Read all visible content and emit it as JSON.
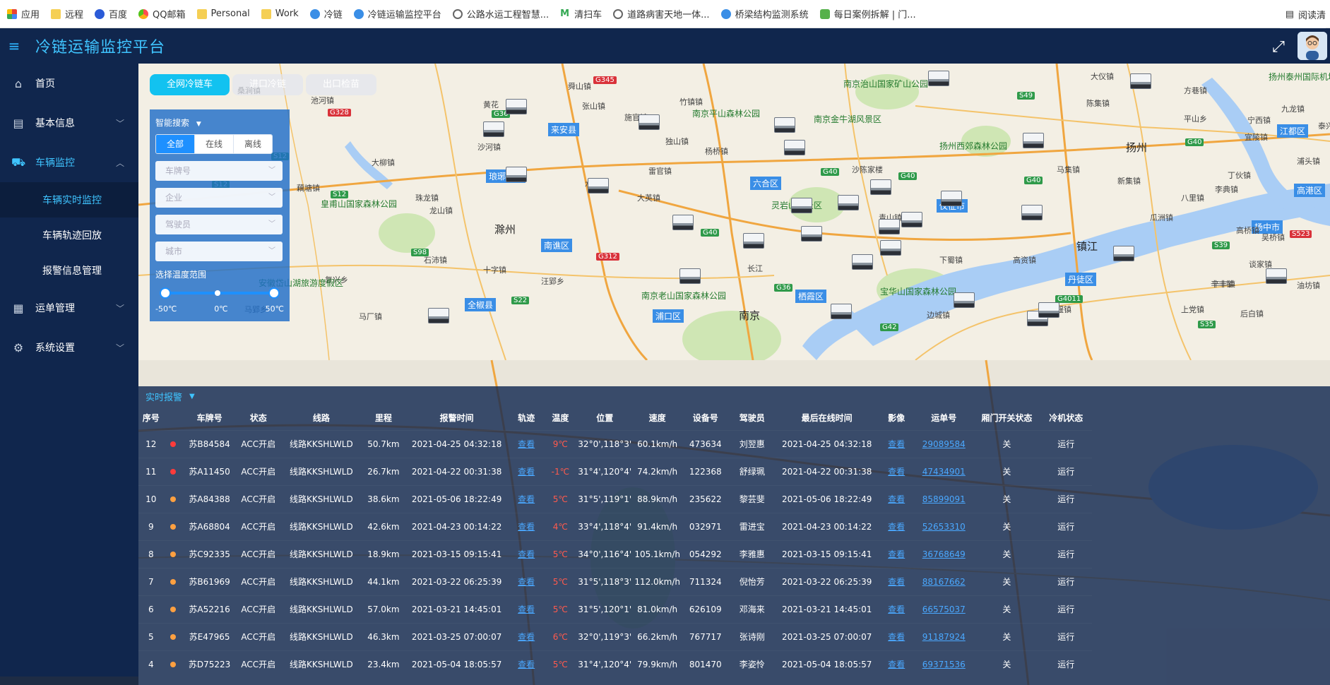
{
  "bookmarks": [
    {
      "label": "应用",
      "icon": "apps-grid-icon",
      "cls": "grid"
    },
    {
      "label": "远程",
      "icon": "folder-icon",
      "cls": "folder"
    },
    {
      "label": "百度",
      "icon": "baidu-paw-icon",
      "cls": "paw"
    },
    {
      "label": "QQ邮箱",
      "icon": "qq-mail-icon",
      "cls": "multi"
    },
    {
      "label": "Personal",
      "icon": "folder-icon",
      "cls": "folder"
    },
    {
      "label": "Work",
      "icon": "folder-icon",
      "cls": "folder"
    },
    {
      "label": "冷链",
      "icon": "site-icon",
      "cls": "blue"
    },
    {
      "label": "冷链运输监控平台",
      "icon": "site-icon",
      "cls": "blue"
    },
    {
      "label": "公路水运工程智慧...",
      "icon": "globe-icon",
      "cls": "globe"
    },
    {
      "label": "清扫车",
      "icon": "m-letter-icon",
      "cls": "mletter"
    },
    {
      "label": "道路病害天地一体...",
      "icon": "globe-icon",
      "cls": "globe"
    },
    {
      "label": "桥梁结构监测系统",
      "icon": "site-icon",
      "cls": "blue"
    },
    {
      "label": "每日案例拆解 | 门...",
      "icon": "bookmark-icon",
      "cls": "green"
    }
  ],
  "reading_list": "阅读清",
  "header": {
    "title": "冷链运输监控平台"
  },
  "sidebar": {
    "items": [
      {
        "label": "首页"
      },
      {
        "label": "基本信息"
      },
      {
        "label": "车辆监控"
      },
      {
        "label": "运单管理"
      },
      {
        "label": "系统设置"
      }
    ],
    "sub_items": [
      {
        "label": "车辆实时监控"
      },
      {
        "label": "车辆轨迹回放"
      },
      {
        "label": "报警信息管理"
      }
    ]
  },
  "map_tabs": [
    {
      "label": "全网冷链车"
    },
    {
      "label": "进口冷链"
    },
    {
      "label": "出口检苗"
    }
  ],
  "search": {
    "title": "智能搜索",
    "filters": [
      "全部",
      "在线",
      "离线"
    ],
    "plate_placeholder": "车牌号",
    "company_placeholder": "企业",
    "driver_placeholder": "驾驶员",
    "city_placeholder": "城市",
    "temp_label": "选择温度范围",
    "temp_min": "-50℃",
    "temp_mid": "0℃",
    "temp_max": "50℃"
  },
  "map_labels": {
    "places": [
      [
        "舜山镇",
        608,
        24,
        "place"
      ],
      [
        "张山镇",
        628,
        52,
        "place"
      ],
      [
        "池河镇",
        244,
        44,
        "place"
      ],
      [
        "桑涧镇",
        140,
        30,
        "place"
      ],
      [
        "黄花",
        488,
        50,
        "place"
      ],
      [
        "沙河镇",
        480,
        110,
        "place"
      ],
      [
        "大柳镇",
        330,
        132,
        "place"
      ],
      [
        "藕塘镇",
        224,
        168,
        "place"
      ],
      [
        "珠龙镇",
        392,
        182,
        "place"
      ],
      [
        "滁州",
        504,
        224,
        "place big"
      ],
      [
        "琅琊新区",
        492,
        150,
        "place blue"
      ],
      [
        "来安县",
        580,
        84,
        "place blue"
      ],
      [
        "施官镇",
        688,
        68,
        "place"
      ],
      [
        "竹镇镇",
        766,
        46,
        "place"
      ],
      [
        "独山镇",
        746,
        102,
        "place"
      ],
      [
        "杨桥镇",
        802,
        116,
        "place"
      ],
      [
        "雷官镇",
        722,
        144,
        "place"
      ],
      [
        "水口镇",
        632,
        162,
        "place"
      ],
      [
        "大英镇",
        706,
        182,
        "place"
      ],
      [
        "南谯区",
        570,
        248,
        "place blue"
      ],
      [
        "石沛镇",
        404,
        270,
        "place"
      ],
      [
        "十字镇",
        488,
        284,
        "place"
      ],
      [
        "汪郢乡",
        570,
        300,
        "place"
      ],
      [
        "全椒县",
        462,
        332,
        "place blue"
      ],
      [
        "复兴乡",
        264,
        298,
        "place"
      ],
      [
        "马厂镇",
        312,
        350,
        "place"
      ],
      [
        "马郢乡",
        150,
        340,
        "place"
      ],
      [
        "龙山镇",
        412,
        200,
        "place"
      ],
      [
        "皇甫山国家森林公园",
        258,
        190,
        "place green"
      ],
      [
        "安徽岱山湖旅游度假区",
        170,
        302,
        "place green"
      ],
      [
        "南京平山森林公园",
        784,
        62,
        "place green"
      ],
      [
        "南京治山国家矿山公园",
        998,
        20,
        "place green"
      ],
      [
        "南京金牛湖风景区",
        956,
        70,
        "place green"
      ],
      [
        "大仪镇",
        1348,
        10,
        "place"
      ],
      [
        "方巷镇",
        1480,
        30,
        "place"
      ],
      [
        "陈集镇",
        1342,
        48,
        "place"
      ],
      [
        "平山乡",
        1480,
        70,
        "place"
      ],
      [
        "扬州西郊森林公园",
        1134,
        108,
        "place green"
      ],
      [
        "扬州",
        1398,
        108,
        "place big"
      ],
      [
        "马集镇",
        1300,
        142,
        "place"
      ],
      [
        "新集镇",
        1386,
        158,
        "place"
      ],
      [
        "沙陈家楼",
        1010,
        142,
        "place"
      ],
      [
        "六合区",
        866,
        160,
        "place blue"
      ],
      [
        "灵岩山风景区",
        896,
        192,
        "place green"
      ],
      [
        "青山镇",
        1048,
        210,
        "place"
      ],
      [
        "仪征市",
        1130,
        192,
        "place blue"
      ],
      [
        "八里镇",
        1476,
        182,
        "place"
      ],
      [
        "瓜洲镇",
        1432,
        210,
        "place"
      ],
      [
        "扬中市",
        1576,
        222,
        "place blue"
      ],
      [
        "镇江",
        1328,
        248,
        "place big"
      ],
      [
        "下蜀镇",
        1134,
        270,
        "place"
      ],
      [
        "高资镇",
        1238,
        270,
        "place"
      ],
      [
        "高桥镇",
        1554,
        228,
        "place"
      ],
      [
        "丹徒区",
        1312,
        296,
        "place blue"
      ],
      [
        "宝华山国家森林公园",
        1050,
        314,
        "place green"
      ],
      [
        "栖霞区",
        930,
        320,
        "place blue"
      ],
      [
        "南京",
        850,
        346,
        "place big"
      ],
      [
        "浦口区",
        728,
        348,
        "place blue"
      ],
      [
        "南京老山国家森林公园",
        712,
        320,
        "place green"
      ],
      [
        "长江",
        862,
        282,
        "place"
      ],
      [
        "边城镇",
        1116,
        348,
        "place"
      ],
      [
        "宝堰镇",
        1288,
        340,
        "place"
      ],
      [
        "上党镇",
        1476,
        340,
        "place"
      ],
      [
        "辛丰镇",
        1518,
        304,
        "place"
      ],
      [
        "谈家镇",
        1572,
        276,
        "place"
      ],
      [
        "扬州泰州国际机场",
        1600,
        10,
        "place green"
      ],
      [
        "江都区",
        1612,
        86,
        "place blue"
      ],
      [
        "九龙镇",
        1618,
        56,
        "place"
      ],
      [
        "浦头镇",
        1640,
        130,
        "place"
      ],
      [
        "高港区",
        1636,
        170,
        "place blue"
      ],
      [
        "油坊镇",
        1640,
        306,
        "place"
      ],
      [
        "辛丰镇",
        1520,
        304,
        "place"
      ],
      [
        "宜陵镇",
        1566,
        96,
        "place"
      ],
      [
        "宁西镇",
        1570,
        72,
        "place"
      ],
      [
        "丁伙镇",
        1542,
        150,
        "place"
      ],
      [
        "李典镇",
        1524,
        170,
        "place"
      ],
      [
        "后白镇",
        1560,
        346,
        "place"
      ],
      [
        "吴桥镇",
        1590,
        238,
        "place"
      ],
      [
        "泰兴",
        1670,
        80,
        "place"
      ]
    ],
    "roads": [
      [
        "G345",
        644,
        18,
        "r"
      ],
      [
        "G328",
        268,
        64,
        "r"
      ],
      [
        "G312",
        648,
        268,
        "r"
      ],
      [
        "S49",
        1244,
        40,
        "g"
      ],
      [
        "S12",
        104,
        166,
        "g"
      ],
      [
        "S12",
        272,
        180,
        "g"
      ],
      [
        "S12",
        188,
        126,
        "g"
      ],
      [
        "G36",
        500,
        66,
        "g"
      ],
      [
        "G40",
        966,
        148,
        "g"
      ],
      [
        "G40",
        1076,
        154,
        "g"
      ],
      [
        "G40",
        1254,
        160,
        "g"
      ],
      [
        "G40",
        1482,
        106,
        "g"
      ],
      [
        "G40",
        796,
        234,
        "g"
      ],
      [
        "S98",
        386,
        262,
        "g"
      ],
      [
        "S22",
        528,
        330,
        "g"
      ],
      [
        "G36",
        900,
        312,
        "g"
      ],
      [
        "G4011",
        1298,
        328,
        "g"
      ],
      [
        "S39",
        1520,
        252,
        "g"
      ],
      [
        "S35",
        1500,
        364,
        "g"
      ],
      [
        "G42",
        1050,
        368,
        "g"
      ],
      [
        "S523",
        1630,
        236,
        "r"
      ]
    ]
  },
  "alarm": {
    "title": "实时报警",
    "columns": [
      "序号",
      "",
      "车牌号",
      "状态",
      "线路",
      "里程",
      "报警时间",
      "轨迹",
      "温度",
      "位置",
      "速度",
      "设备号",
      "驾驶员",
      "最后在线时间",
      "影像",
      "运单号",
      "厢门开关状态",
      "冷机状态"
    ],
    "rows": [
      {
        "no": "12",
        "dot": "#ff3b3b",
        "plate": "苏B84584",
        "status": "ACC开启",
        "route": "线路KKSHLWLD",
        "mileage": "50.7km",
        "alarm_time": "2021-04-25 04:32:18",
        "track": "查看",
        "temp": "9℃",
        "pos": "32°0',118°3'",
        "speed": "60.1km/h",
        "device": "473634",
        "driver": "刘翌惠",
        "last_online": "2021-04-25 04:32:18",
        "image": "查看",
        "waybill": "29089584",
        "door": "关",
        "cooler": "运行"
      },
      {
        "no": "11",
        "dot": "#ff3b3b",
        "plate": "苏A11450",
        "status": "ACC开启",
        "route": "线路KKSHLWLD",
        "mileage": "26.7km",
        "alarm_time": "2021-04-22 00:31:38",
        "track": "查看",
        "temp": "-1℃",
        "pos": "31°4',120°4'",
        "speed": "74.2km/h",
        "device": "122368",
        "driver": "舒绿珮",
        "last_online": "2021-04-22 00:31:38",
        "image": "查看",
        "waybill": "47434901",
        "door": "关",
        "cooler": "运行"
      },
      {
        "no": "10",
        "dot": "#ffa040",
        "plate": "苏A84388",
        "status": "ACC开启",
        "route": "线路KKSHLWLD",
        "mileage": "38.6km",
        "alarm_time": "2021-05-06 18:22:49",
        "track": "查看",
        "temp": "5℃",
        "pos": "31°5',119°1'",
        "speed": "88.9km/h",
        "device": "235622",
        "driver": "黎芸斐",
        "last_online": "2021-05-06 18:22:49",
        "image": "查看",
        "waybill": "85899091",
        "door": "关",
        "cooler": "运行"
      },
      {
        "no": "9",
        "dot": "#ffa040",
        "plate": "苏A68804",
        "status": "ACC开启",
        "route": "线路KKSHLWLD",
        "mileage": "42.6km",
        "alarm_time": "2021-04-23 00:14:22",
        "track": "查看",
        "temp": "4℃",
        "pos": "33°4',118°4'",
        "speed": "91.4km/h",
        "device": "032971",
        "driver": "雷进宝",
        "last_online": "2021-04-23 00:14:22",
        "image": "查看",
        "waybill": "52653310",
        "door": "关",
        "cooler": "运行"
      },
      {
        "no": "8",
        "dot": "#ffa040",
        "plate": "苏C92335",
        "status": "ACC开启",
        "route": "线路KKSHLWLD",
        "mileage": "18.9km",
        "alarm_time": "2021-03-15 09:15:41",
        "track": "查看",
        "temp": "5℃",
        "pos": "34°0',116°4'",
        "speed": "105.1km/h",
        "device": "054292",
        "driver": "李雅惠",
        "last_online": "2021-03-15 09:15:41",
        "image": "查看",
        "waybill": "36768649",
        "door": "关",
        "cooler": "运行"
      },
      {
        "no": "7",
        "dot": "#ffa040",
        "plate": "苏B61969",
        "status": "ACC开启",
        "route": "线路KKSHLWLD",
        "mileage": "44.1km",
        "alarm_time": "2021-03-22 06:25:39",
        "track": "查看",
        "temp": "5℃",
        "pos": "31°5',118°3'",
        "speed": "112.0km/h",
        "device": "711324",
        "driver": "倪怡芳",
        "last_online": "2021-03-22 06:25:39",
        "image": "查看",
        "waybill": "88167662",
        "door": "关",
        "cooler": "运行"
      },
      {
        "no": "6",
        "dot": "#ffa040",
        "plate": "苏A52216",
        "status": "ACC开启",
        "route": "线路KKSHLWLD",
        "mileage": "57.0km",
        "alarm_time": "2021-03-21 14:45:01",
        "track": "查看",
        "temp": "5℃",
        "pos": "31°5',120°1'",
        "speed": "81.0km/h",
        "device": "626109",
        "driver": "邓海来",
        "last_online": "2021-03-21 14:45:01",
        "image": "查看",
        "waybill": "66575037",
        "door": "关",
        "cooler": "运行"
      },
      {
        "no": "5",
        "dot": "#ffa040",
        "plate": "苏E47965",
        "status": "ACC开启",
        "route": "线路KKSHLWLD",
        "mileage": "46.3km",
        "alarm_time": "2021-03-25 07:00:07",
        "track": "查看",
        "temp": "6℃",
        "pos": "32°0',119°3'",
        "speed": "66.2km/h",
        "device": "767717",
        "driver": "张诗刚",
        "last_online": "2021-03-25 07:00:07",
        "image": "查看",
        "waybill": "91187924",
        "door": "关",
        "cooler": "运行"
      },
      {
        "no": "4",
        "dot": "#ffa040",
        "plate": "苏D75223",
        "status": "ACC开启",
        "route": "线路KKSHLWLD",
        "mileage": "23.4km",
        "alarm_time": "2021-05-04 18:05:57",
        "track": "查看",
        "temp": "5℃",
        "pos": "31°4',120°4'",
        "speed": "79.9km/h",
        "device": "801470",
        "driver": "李姿怜",
        "last_online": "2021-05-04 18:05:57",
        "image": "查看",
        "waybill": "69371536",
        "door": "关",
        "cooler": "运行"
      }
    ]
  },
  "colors": {
    "accent": "#3fc4ff",
    "alarm_red": "#ff3b3b",
    "alarm_orange": "#ffa040",
    "link": "#4aa8ff",
    "sidebar_bg": "#10264d"
  }
}
